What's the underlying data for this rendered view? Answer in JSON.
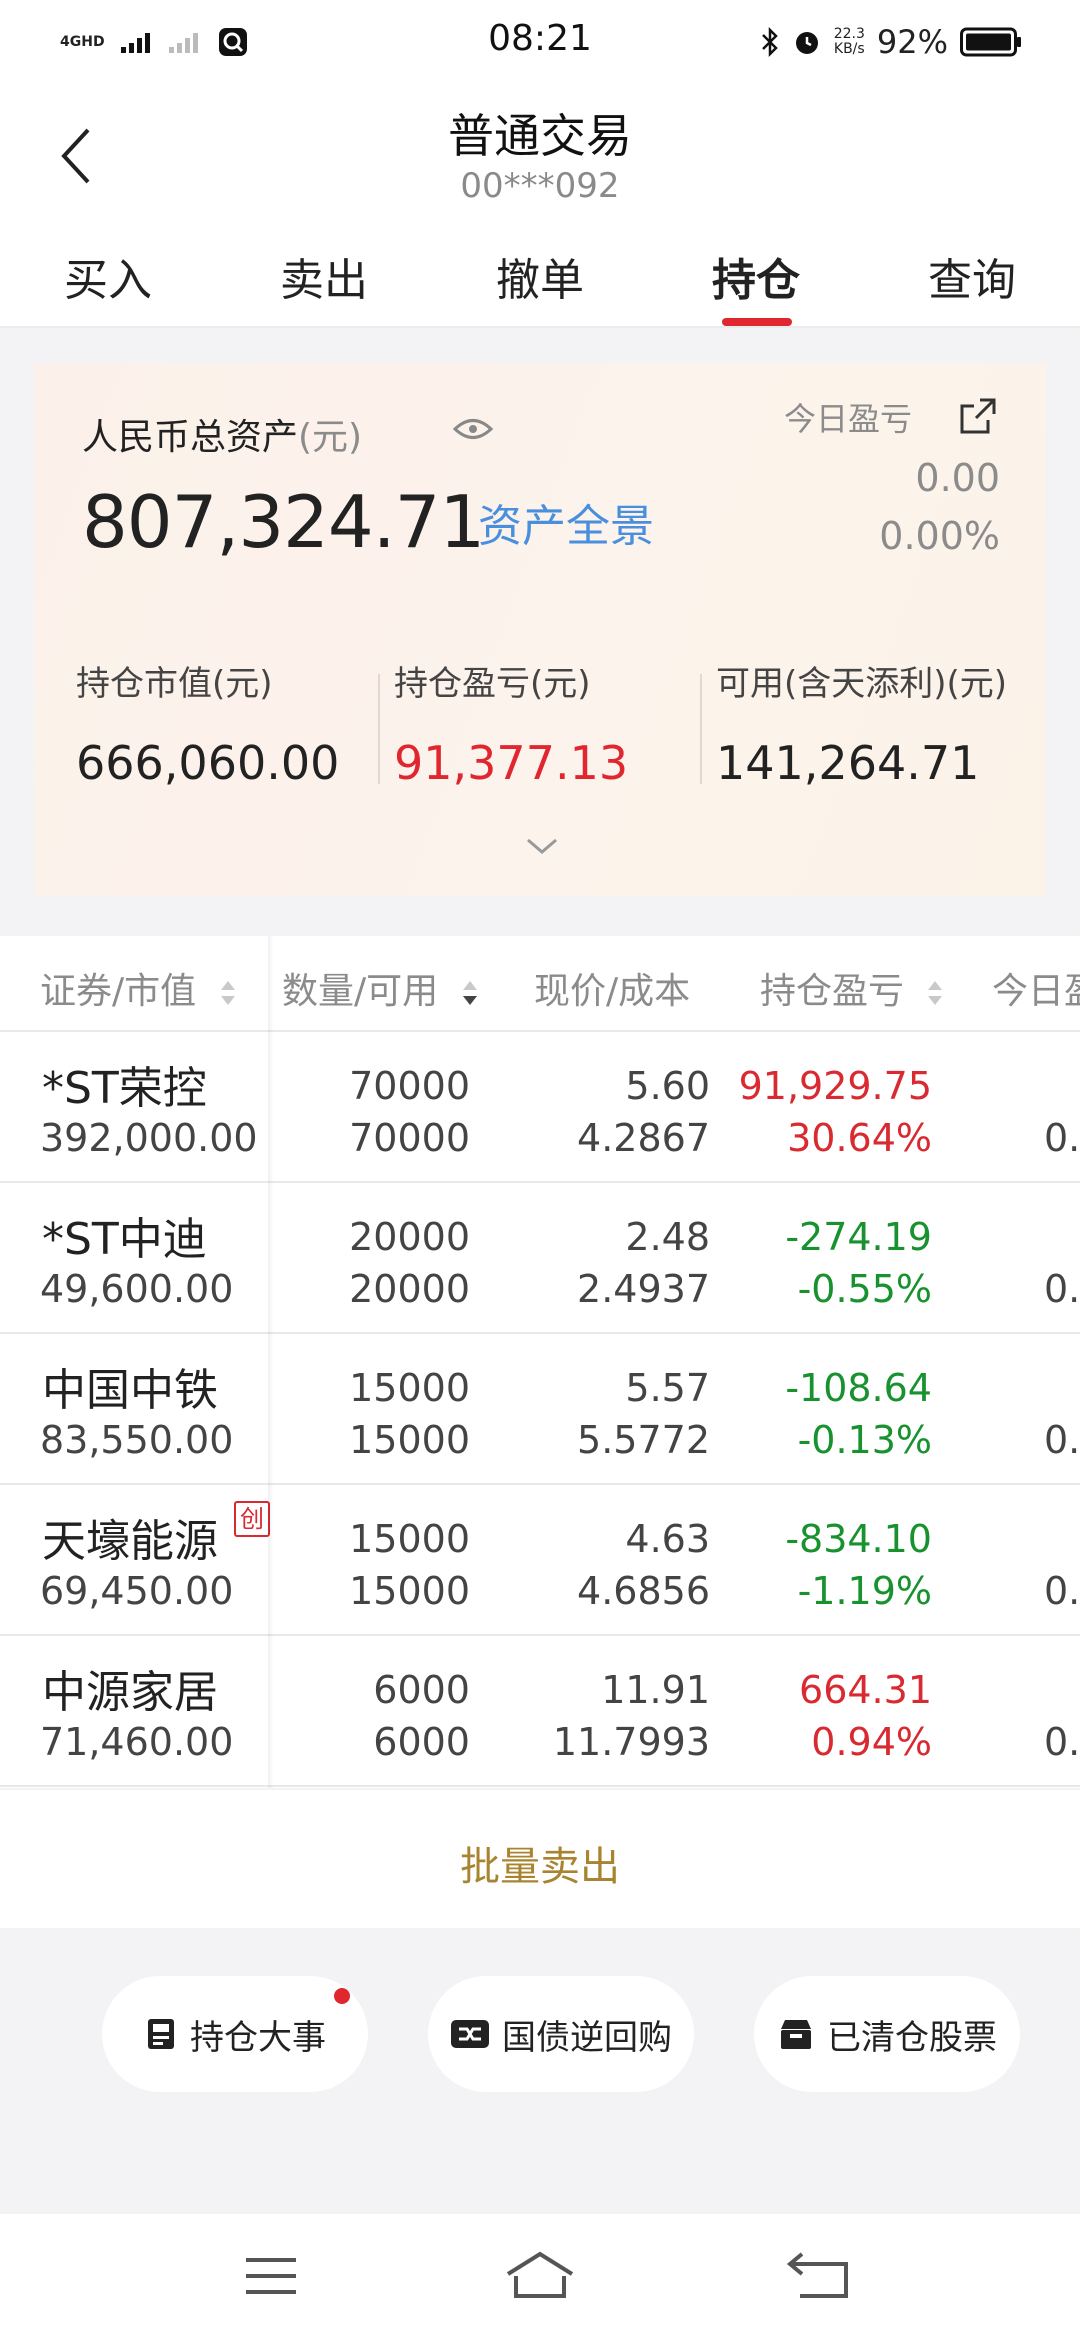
{
  "status_bar": {
    "network": "4GHD",
    "time": "08:21",
    "speed_value": "22.3",
    "speed_unit": "KB/s",
    "battery": "92%"
  },
  "header": {
    "title": "普通交易",
    "account": "00***092"
  },
  "tabs": [
    {
      "label": "买入"
    },
    {
      "label": "卖出"
    },
    {
      "label": "撤单"
    },
    {
      "label": "持仓",
      "active": true
    },
    {
      "label": "查询"
    }
  ],
  "asset": {
    "rmb_label": "人民币总资产",
    "rmb_unit": "(元)",
    "total": "807,324.71",
    "panorama_link": "资产全景",
    "today_label": "今日盈亏",
    "today_value": "0.00",
    "today_pct": "0.00%",
    "market_value_label": "持仓市值(元)",
    "market_value": "666,060.00",
    "position_pl_label": "持仓盈亏(元)",
    "position_pl": "91,377.13",
    "available_label": "可用(含天添利)(元)",
    "available": "141,264.71"
  },
  "table": {
    "headers": [
      "证券/市值",
      "数量/可用",
      "现价/成本",
      "持仓盈亏",
      "今日盈"
    ],
    "rows": [
      {
        "name": "*ST荣控",
        "market_value": "392,000.00",
        "qty": "70000",
        "avail": "70000",
        "price": "5.60",
        "cost": "4.2867",
        "pl": "91,929.75",
        "pl_pct": "30.64%",
        "today": "0.",
        "positive": true,
        "badge": ""
      },
      {
        "name": "*ST中迪",
        "market_value": "49,600.00",
        "qty": "20000",
        "avail": "20000",
        "price": "2.48",
        "cost": "2.4937",
        "pl": "-274.19",
        "pl_pct": "-0.55%",
        "today": "0.",
        "positive": false,
        "badge": ""
      },
      {
        "name": "中国中铁",
        "market_value": "83,550.00",
        "qty": "15000",
        "avail": "15000",
        "price": "5.57",
        "cost": "5.5772",
        "pl": "-108.64",
        "pl_pct": "-0.13%",
        "today": "0.",
        "positive": false,
        "badge": ""
      },
      {
        "name": "天壕能源",
        "market_value": "69,450.00",
        "qty": "15000",
        "avail": "15000",
        "price": "4.63",
        "cost": "4.6856",
        "pl": "-834.10",
        "pl_pct": "-1.19%",
        "today": "0.",
        "positive": false,
        "badge": "创"
      },
      {
        "name": "中源家居",
        "market_value": "71,460.00",
        "qty": "6000",
        "avail": "6000",
        "price": "11.91",
        "cost": "11.7993",
        "pl": "664.31",
        "pl_pct": "0.94%",
        "today": "0.",
        "positive": true,
        "badge": ""
      }
    ]
  },
  "batch_sell": "批量卖出",
  "quick_actions": [
    {
      "label": "持仓大事",
      "icon": "news-icon"
    },
    {
      "label": "国债逆回购",
      "icon": "repo-icon"
    },
    {
      "label": "已清仓股票",
      "icon": "archive-box-icon"
    }
  ],
  "colors": {
    "accent_red": "#e0272f",
    "profit_red": "#d82a30",
    "loss_green": "#18922f",
    "link_blue": "#4a8fde",
    "gold": "#a88431"
  }
}
